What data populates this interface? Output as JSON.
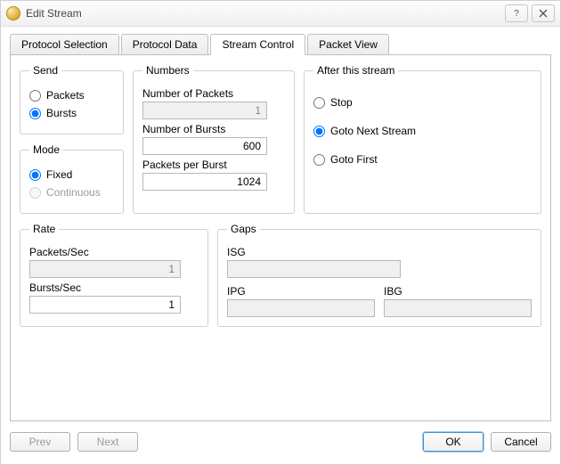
{
  "window": {
    "title": "Edit Stream"
  },
  "tabs": [
    {
      "label": "Protocol Selection",
      "selected": false
    },
    {
      "label": "Protocol Data",
      "selected": false
    },
    {
      "label": "Stream Control",
      "selected": true
    },
    {
      "label": "Packet View",
      "selected": false
    }
  ],
  "send": {
    "legend": "Send",
    "options": {
      "packets": "Packets",
      "bursts": "Bursts"
    },
    "selected": "bursts"
  },
  "mode": {
    "legend": "Mode",
    "options": {
      "fixed": "Fixed",
      "continuous": "Continuous"
    },
    "selected": "fixed",
    "continuous_enabled": false
  },
  "numbers": {
    "legend": "Numbers",
    "num_packets_label": "Number of Packets",
    "num_packets_value": "1",
    "num_packets_enabled": false,
    "num_bursts_label": "Number of Bursts",
    "num_bursts_value": "600",
    "ppb_label": "Packets per Burst",
    "ppb_value": "1024"
  },
  "after": {
    "legend": "After this stream",
    "options": {
      "stop": "Stop",
      "next": "Goto Next Stream",
      "first": "Goto First"
    },
    "selected": "next"
  },
  "rate": {
    "legend": "Rate",
    "pps_label": "Packets/Sec",
    "pps_value": "1",
    "pps_enabled": false,
    "bps_label": "Bursts/Sec",
    "bps_value": "1"
  },
  "gaps": {
    "legend": "Gaps",
    "isg_label": "ISG",
    "isg_value": "",
    "isg_enabled": false,
    "ipg_label": "IPG",
    "ipg_value": "",
    "ipg_enabled": false,
    "ibg_label": "IBG",
    "ibg_value": "",
    "ibg_enabled": false
  },
  "buttons": {
    "prev": "Prev",
    "next": "Next",
    "ok": "OK",
    "cancel": "Cancel",
    "prev_enabled": false,
    "next_enabled": false
  }
}
